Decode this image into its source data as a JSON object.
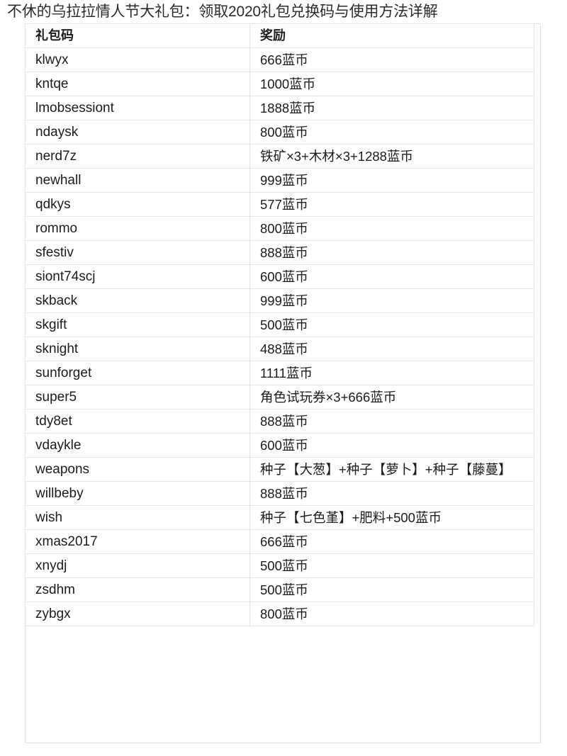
{
  "page": {
    "title": "不休的乌拉拉情人节大礼包：领取2020礼包兑换码与使用方法详解"
  },
  "table": {
    "headers": {
      "code": "礼包码",
      "reward": "奖励"
    },
    "rows": [
      {
        "code": "klwyx",
        "reward": "666蓝币"
      },
      {
        "code": "kntqe",
        "reward": "1000蓝币"
      },
      {
        "code": "lmobsessiont",
        "reward": "1888蓝币"
      },
      {
        "code": "ndaysk",
        "reward": "800蓝币"
      },
      {
        "code": "nerd7z",
        "reward": "铁矿×3+木材×3+1288蓝币"
      },
      {
        "code": "newhall",
        "reward": "999蓝币"
      },
      {
        "code": "qdkys",
        "reward": "577蓝币"
      },
      {
        "code": "rommo",
        "reward": "800蓝币"
      },
      {
        "code": "sfestiv",
        "reward": "888蓝币"
      },
      {
        "code": "siont74scj",
        "reward": "600蓝币"
      },
      {
        "code": "skback",
        "reward": "999蓝币"
      },
      {
        "code": "skgift",
        "reward": "500蓝币"
      },
      {
        "code": "sknight",
        "reward": "488蓝币"
      },
      {
        "code": "sunforget",
        "reward": "1111蓝币"
      },
      {
        "code": "super5",
        "reward": "角色试玩券×3+666蓝币"
      },
      {
        "code": "tdy8et",
        "reward": "888蓝币"
      },
      {
        "code": "vdaykle",
        "reward": "600蓝币"
      },
      {
        "code": "weapons",
        "reward": "种子【大葱】+种子【萝卜】+种子【藤蔓】"
      },
      {
        "code": "willbeby",
        "reward": "888蓝币"
      },
      {
        "code": "wish",
        "reward": "种子【七色堇】+肥料+500蓝币"
      },
      {
        "code": "xmas2017",
        "reward": "666蓝币"
      },
      {
        "code": "xnydj",
        "reward": "500蓝币"
      },
      {
        "code": "zsdhm",
        "reward": "500蓝币"
      },
      {
        "code": "zybgx",
        "reward": "800蓝币"
      }
    ]
  }
}
